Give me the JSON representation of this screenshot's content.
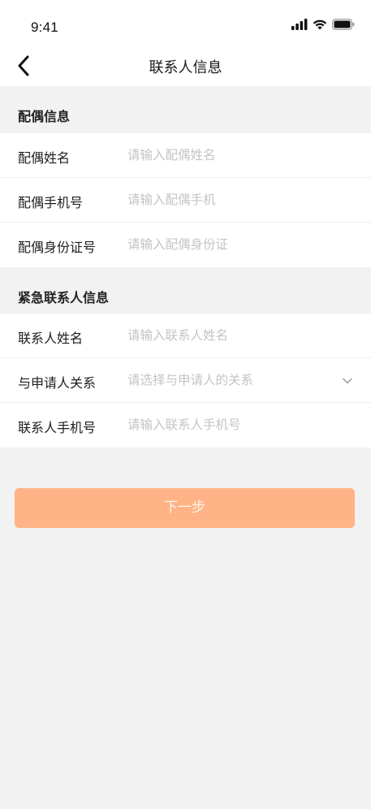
{
  "status_bar": {
    "time": "9:41",
    "icons": [
      "signal-icon",
      "wifi-icon",
      "battery-icon"
    ]
  },
  "nav": {
    "back_icon": "chevron-left-icon",
    "title": "联系人信息"
  },
  "spouse_section": {
    "title": "配偶信息",
    "fields": [
      {
        "label": "配偶姓名",
        "placeholder": "请输入配偶姓名",
        "value": ""
      },
      {
        "label": "配偶手机号",
        "placeholder": "请输入配偶手机",
        "value": ""
      },
      {
        "label": "配偶身份证号",
        "placeholder": "请输入配偶身份证",
        "value": ""
      }
    ]
  },
  "emergency_section": {
    "title": "紧急联系人信息",
    "fields": [
      {
        "label": "联系人姓名",
        "placeholder": "请输入联系人姓名",
        "value": ""
      },
      {
        "label": "与申请人关系",
        "placeholder": "请选择与申请人的关系",
        "value": "",
        "icon": "chevron-down-icon"
      },
      {
        "label": "联系人手机号",
        "placeholder": "请输入联系人手机号",
        "value": ""
      }
    ]
  },
  "actions": {
    "next_label": "下一步"
  },
  "colors": {
    "accent": "#ffb386",
    "background": "#f2f2f3",
    "placeholder": "#c4c4c8"
  }
}
